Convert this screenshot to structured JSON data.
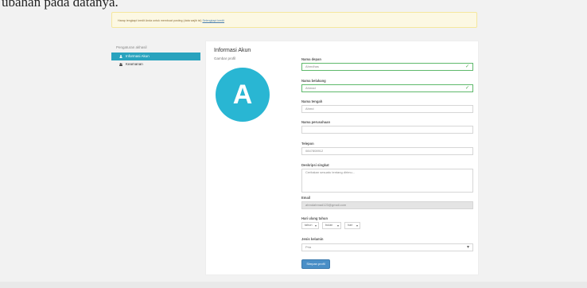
{
  "caption": "ubahan pada datanya.",
  "alert": {
    "text": "Harap lengkapi kredit Anda untuk membuat posting (data wajib isi) ",
    "link": "Selengkapi kredit"
  },
  "sidebar": {
    "title": "Pengaturan akhasil",
    "items": [
      {
        "label": "Informasi Akun"
      },
      {
        "label": "Keamanan"
      }
    ]
  },
  "panel": {
    "title": "Informasi Akun",
    "photo_label": "Gambar profil",
    "avatar_letter": "A"
  },
  "form": {
    "first_name": {
      "label": "Nama depan",
      "value": "Ahmdhas"
    },
    "last_name": {
      "label": "Nama belakang",
      "value": "Ahmad"
    },
    "middle_name": {
      "label": "Nama tengah",
      "value": "Ahmd"
    },
    "company": {
      "label": "Nama perusahaan",
      "value": ""
    },
    "phone": {
      "label": "Telepon",
      "value": "0847808912"
    },
    "description": {
      "label": "Deskripsi singkat",
      "placeholder": "Ceritakan sesuatu tentang dirimu..."
    },
    "email": {
      "label": "Email",
      "value": "ahmdahmad123@gmail.com"
    },
    "birth": {
      "label": "Hari ulang tahun",
      "year": "tahun",
      "month": "bulan",
      "day": "hari"
    },
    "gender": {
      "label": "Jenis kelamin",
      "value": "Pria"
    },
    "save_label": "Simpan profil"
  }
}
